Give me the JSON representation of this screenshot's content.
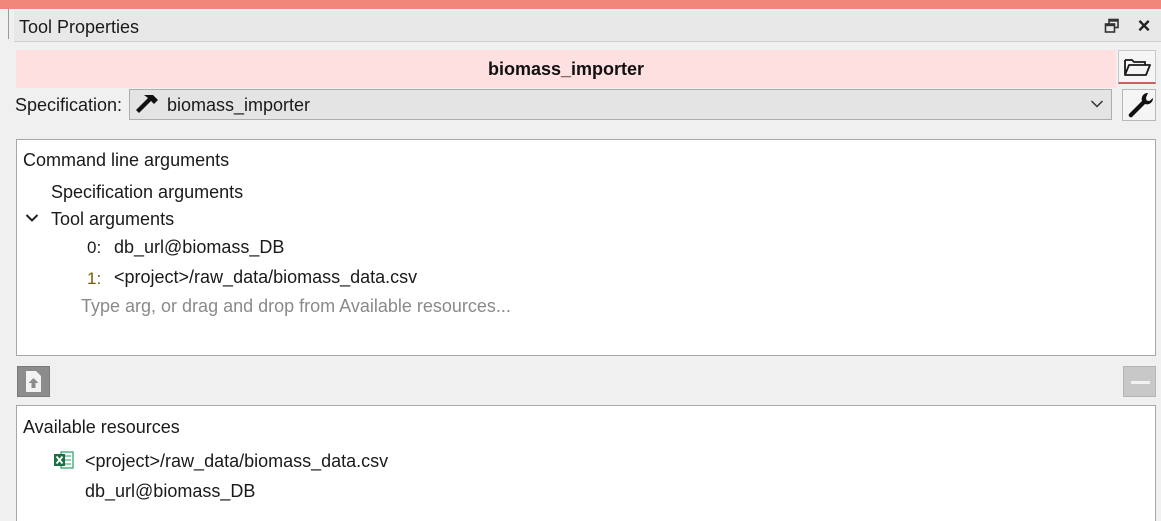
{
  "window": {
    "title": "Tool Properties",
    "float_icon": "float-window-icon",
    "close_icon": "close-icon"
  },
  "tool": {
    "name": "biomass_importer",
    "name_bar_color": "#ffe0e0",
    "open_folder_icon": "folder-open-icon"
  },
  "specification": {
    "label": "Specification:",
    "value": "biomass_importer",
    "icon": "hammer-icon",
    "edit_icon": "wrench-icon"
  },
  "command_line": {
    "header": "Command line arguments",
    "spec_args_label": "Specification arguments",
    "tool_args_label": "Tool arguments",
    "tool_args": [
      {
        "index": "0:",
        "value": "db_url@biomass_DB"
      },
      {
        "index": "1:",
        "value": "<project>/raw_data/biomass_data.csv"
      }
    ],
    "placeholder": "Type arg, or drag and drop from Available resources..."
  },
  "resources": {
    "header": "Available resources",
    "items": [
      {
        "icon": "excel-file-icon",
        "label": "<project>/raw_data/biomass_data.csv"
      },
      {
        "icon": "",
        "label": "db_url@biomass_DB"
      }
    ]
  },
  "colors": {
    "accent": "#f0877a",
    "add_button": "#8c8c8c",
    "remove_button": "#c8c8c8"
  }
}
